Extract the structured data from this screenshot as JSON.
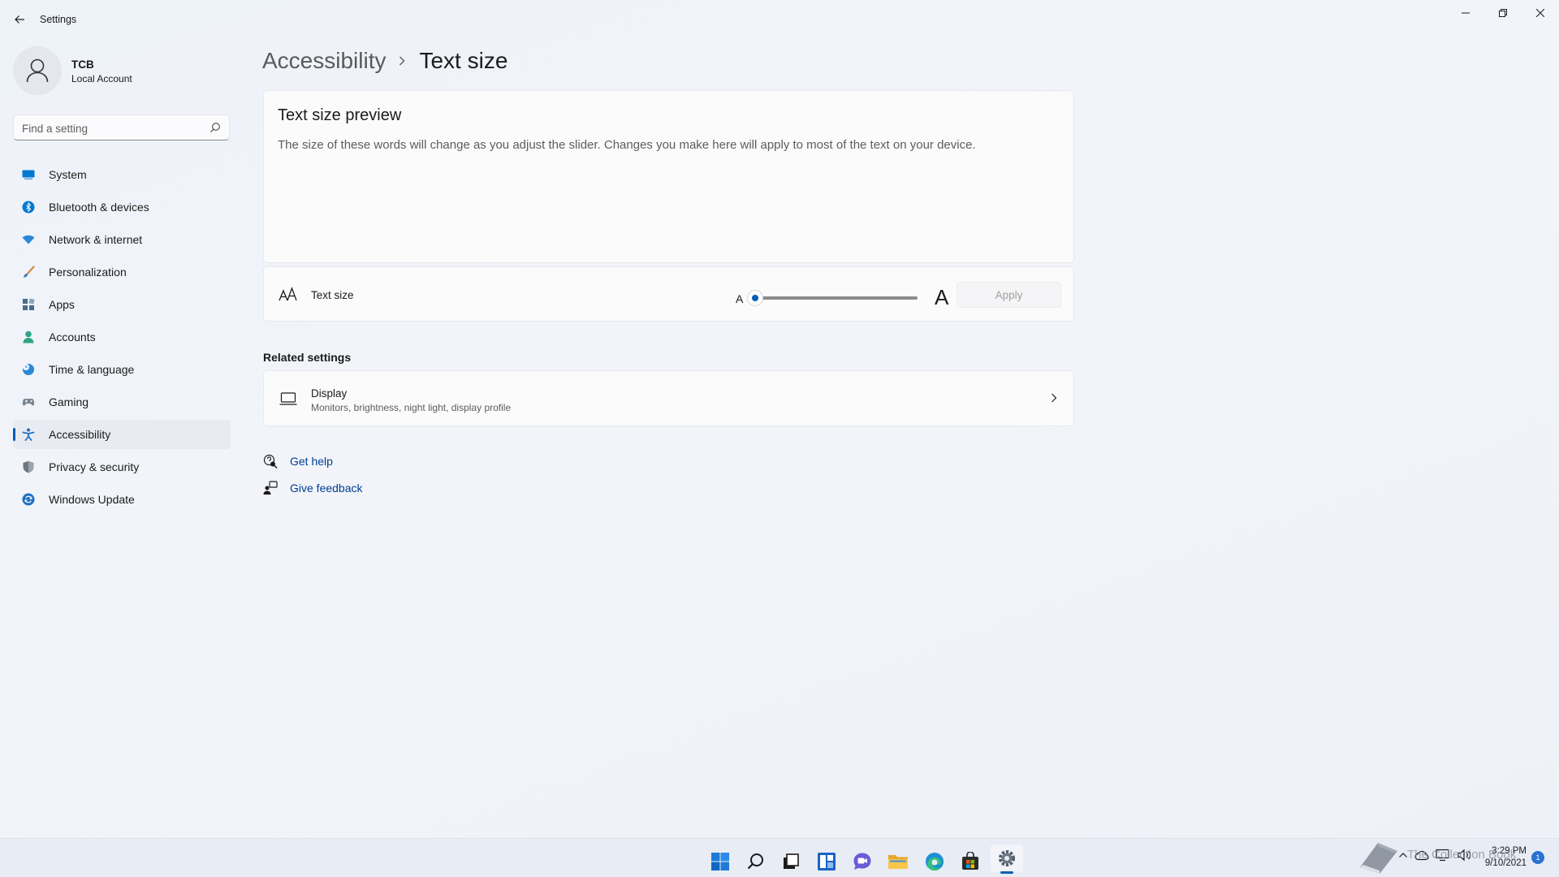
{
  "window": {
    "title": "Settings"
  },
  "profile": {
    "name": "TCB",
    "account_type": "Local Account"
  },
  "search": {
    "placeholder": "Find a setting",
    "value": ""
  },
  "sidebar": {
    "items": [
      {
        "label": "System",
        "icon": "system-icon",
        "color": "#0078d4"
      },
      {
        "label": "Bluetooth & devices",
        "icon": "bluetooth-icon",
        "color": "#0078d4"
      },
      {
        "label": "Network & internet",
        "icon": "wifi-icon",
        "color": "#2b88d8"
      },
      {
        "label": "Personalization",
        "icon": "brush-icon",
        "color": "#d08a3a"
      },
      {
        "label": "Apps",
        "icon": "apps-icon",
        "color": "#4a6c8c"
      },
      {
        "label": "Accounts",
        "icon": "accounts-icon",
        "color": "#2fa385"
      },
      {
        "label": "Time & language",
        "icon": "globe-clock-icon",
        "color": "#2b88d8"
      },
      {
        "label": "Gaming",
        "icon": "gamepad-icon",
        "color": "#7a8694"
      },
      {
        "label": "Accessibility",
        "icon": "accessibility-icon",
        "color": "#1f6fc4",
        "selected": true
      },
      {
        "label": "Privacy & security",
        "icon": "shield-icon",
        "color": "#6d7681"
      },
      {
        "label": "Windows Update",
        "icon": "update-icon",
        "color": "#1f6fc4"
      }
    ]
  },
  "breadcrumb": {
    "parent": "Accessibility",
    "current": "Text size"
  },
  "preview": {
    "title": "Text size preview",
    "text": "The size of these words will change as you adjust the slider. Changes you make here will apply to most of the text on your device."
  },
  "text_size": {
    "label": "Text size",
    "small_glyph": "A",
    "large_glyph": "A",
    "slider_value_percent": 100,
    "slider_min_percent": 100,
    "slider_max_percent": 225,
    "apply_label": "Apply",
    "apply_enabled": false
  },
  "related": {
    "heading": "Related settings",
    "display": {
      "title": "Display",
      "subtitle": "Monitors, brightness, night light, display profile"
    }
  },
  "links": {
    "get_help": "Get help",
    "give_feedback": "Give feedback"
  },
  "taskbar": {
    "apps": [
      "windows-start-icon",
      "search-icon",
      "task-view-icon",
      "widgets-icon",
      "chat-icon",
      "file-explorer-icon",
      "edge-icon",
      "store-icon",
      "settings-icon"
    ],
    "active_app": "settings-icon",
    "time": "3:29 PM",
    "date": "9/10/2021",
    "notification_count": "1"
  },
  "watermark": {
    "text": "The Collection Book"
  },
  "colors": {
    "accent": "#005fb8",
    "link": "#003e92",
    "background": "#f0f3f9"
  }
}
